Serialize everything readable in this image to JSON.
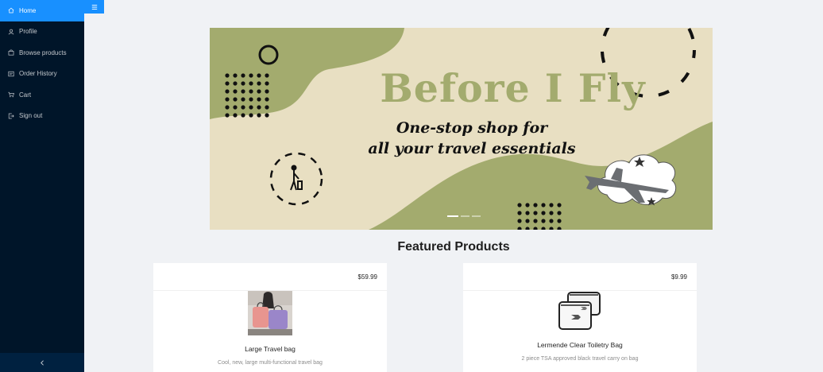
{
  "sidebar": {
    "items": [
      {
        "label": "Home",
        "icon": "home-icon",
        "active": true
      },
      {
        "label": "Profile",
        "icon": "user-icon",
        "active": false
      },
      {
        "label": "Browse products",
        "icon": "shopping-icon",
        "active": false
      },
      {
        "label": "Order History",
        "icon": "order-icon",
        "active": false
      },
      {
        "label": "Cart",
        "icon": "cart-icon",
        "active": false
      },
      {
        "label": "Sign out",
        "icon": "signout-icon",
        "active": false
      }
    ],
    "collapse_icon": "chevron-left-icon"
  },
  "header": {
    "toggle_icon": "menu-icon"
  },
  "banner": {
    "title": "Before I Fly",
    "subtitle_line1": "One-stop shop for",
    "subtitle_line2": "all your travel essentials",
    "slides_count": 3,
    "active_slide": 1
  },
  "featured": {
    "title": "Featured Products",
    "products": [
      {
        "price": "$59.99",
        "name": "Large Travel bag",
        "description": "Cool, new, large multi-functional travel bag"
      },
      {
        "price": "$9.99",
        "name": "Lermende Clear Toiletry Bag",
        "description": "2 piece TSA approved black travel carry on bag"
      }
    ]
  },
  "colors": {
    "sidebar_bg": "#001529",
    "accent": "#1890ff",
    "banner_bg": "#e8dfc2",
    "banner_green": "#a3ab6e"
  }
}
